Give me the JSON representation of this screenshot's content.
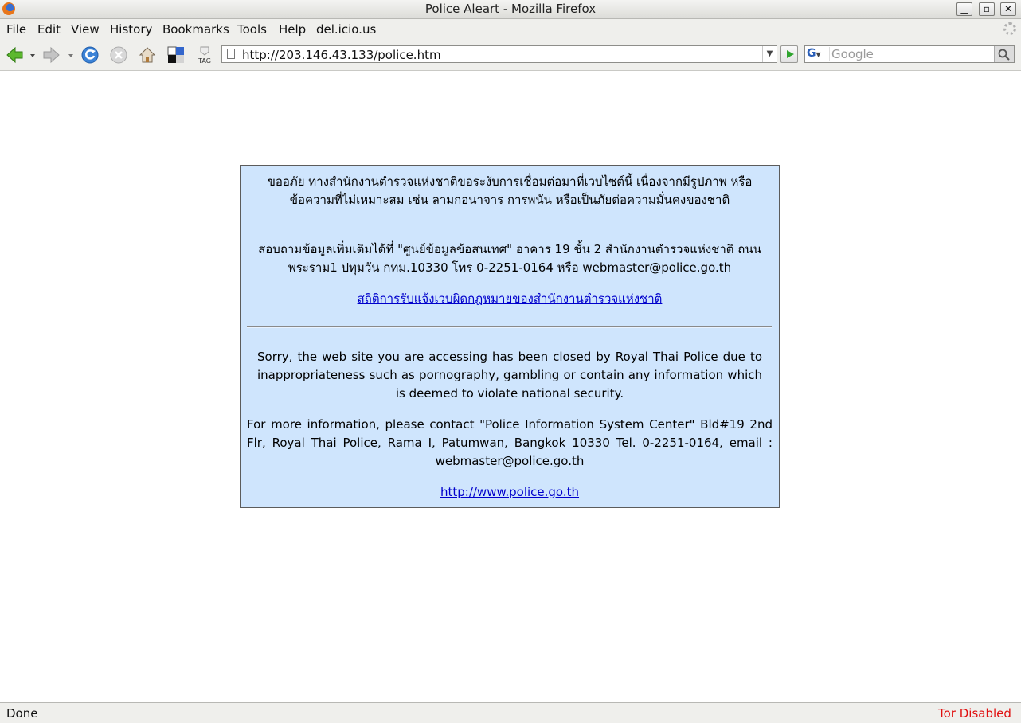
{
  "window": {
    "title": "Police Aleart - Mozilla Firefox"
  },
  "menu": {
    "items": [
      {
        "label": "File"
      },
      {
        "label": "Edit"
      },
      {
        "label": "View"
      },
      {
        "label": "History"
      },
      {
        "label": "Bookmarks"
      },
      {
        "label": "Tools"
      },
      {
        "label": "Help"
      },
      {
        "label": "del.icio.us"
      }
    ]
  },
  "toolbar": {
    "url": "http://203.146.43.133/police.htm",
    "search_placeholder": "Google",
    "tag_label": "TAG",
    "search_engine_letter": "G"
  },
  "notice": {
    "thai_paragraph_1": "ขออภัย ทางสำนักงานตำรวจแห่งชาติขอระงับการเชื่อมต่อมาที่เวบไซต์นี้ เนื่องจากมีรูปภาพ หรือข้อความที่ไม่เหมาะสม เช่น ลามกอนาจาร การพนัน หรือเป็นภัยต่อความมั่นคงของชาติ",
    "thai_paragraph_2": "สอบถามข้อมูลเพิ่มเติมได้ที่ \"ศูนย์ข้อมูลข้อสนเทศ\" อาคาร 19 ชั้น 2 สำนักงานตำรวจแห่งชาติ ถนนพระราม1 ปทุมวัน กทม.10330 โทร 0-2251-0164 หรือ webmaster@police.go.th",
    "thai_link": "สถิติการรับแจ้งเวบผิดกฎหมายของสำนักงานตำรวจแห่งชาติ",
    "english_paragraph_1": "Sorry, the web site you are accessing has been closed by Royal Thai Police due to inappropriateness such as pornography, gambling or contain any information which is deemed to violate national security.",
    "english_paragraph_2": "For more information, please contact \"Police Information System Center\" Bld#19 2nd Flr, Royal Thai Police, Rama I, Patumwan, Bangkok 10330 Tel. 0-2251-0164, email : webmaster@police.go.th",
    "website_link": "http://www.police.go.th"
  },
  "status": {
    "text": "Done",
    "tor": "Tor Disabled",
    "tor_color": "#e01010"
  },
  "colors": {
    "notice_background": "#cfe5fd",
    "link": "#0000cc"
  }
}
